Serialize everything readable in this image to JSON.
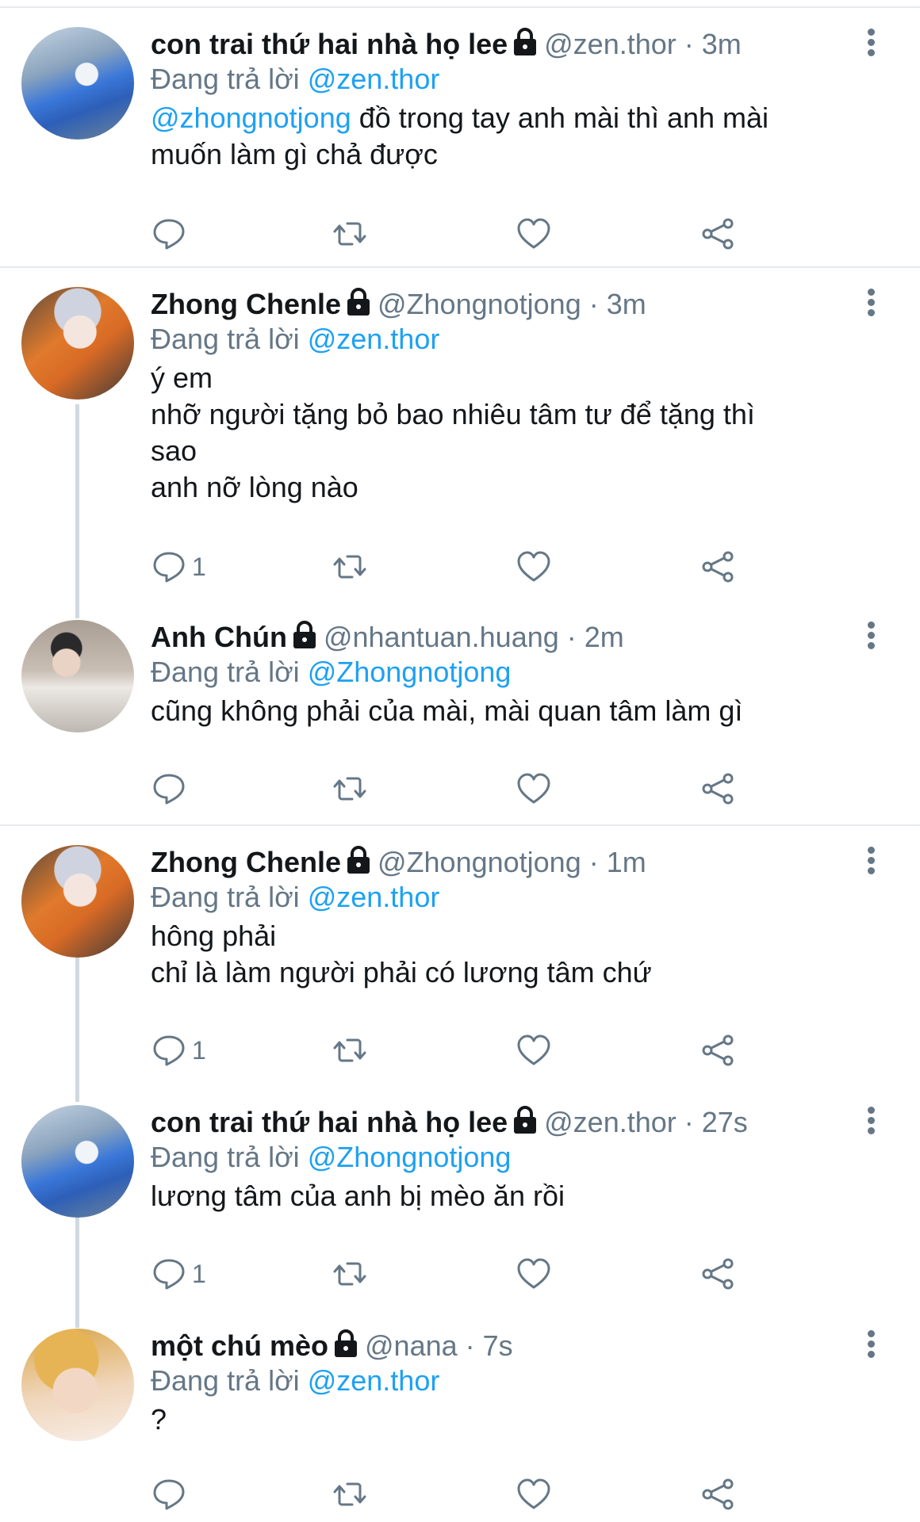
{
  "tweets": [
    {
      "name": "con trai thứ hai nhà họ lee",
      "handle": "@zen.thor",
      "time": "3m",
      "reply_prefix": "Đang trả lời",
      "reply_to": "@zen.thor",
      "mention": "@zhongnotjong",
      "text": " đồ trong tay anh mài thì anh mài\nmuốn làm gì chả được",
      "reply_count": ""
    },
    {
      "name": "Zhong Chenle",
      "handle": "@Zhongnotjong",
      "time": "3m",
      "reply_prefix": "Đang trả lời",
      "reply_to": "@zen.thor",
      "text": "ý em\nnhỡ người tặng bỏ bao nhiêu tâm tư để tặng thì\nsao\nanh nỡ lòng nào",
      "reply_count": "1"
    },
    {
      "name": "Anh Chún",
      "handle": "@nhantuan.huang",
      "time": "2m",
      "reply_prefix": "Đang trả lời",
      "reply_to": "@Zhongnotjong",
      "text": "cũng không phải của mài, mài quan tâm làm gì",
      "reply_count": ""
    },
    {
      "name": "Zhong Chenle",
      "handle": "@Zhongnotjong",
      "time": "1m",
      "reply_prefix": "Đang trả lời",
      "reply_to": "@zen.thor",
      "text": "hông phải\nchỉ là làm người phải có lương tâm chứ",
      "reply_count": "1"
    },
    {
      "name": "con trai thứ hai nhà họ lee",
      "handle": "@zen.thor",
      "time": "27s",
      "reply_prefix": "Đang trả lời",
      "reply_to": "@Zhongnotjong",
      "text": "lương tâm của anh bị mèo ăn rồi",
      "reply_count": "1"
    },
    {
      "name": "một chú mèo",
      "handle": "@nana",
      "time": "7s",
      "reply_prefix": "Đang trả lời",
      "reply_to": "@zen.thor",
      "text": "?",
      "reply_count": ""
    }
  ],
  "separator": " · ",
  "icons": [
    "lock-icon",
    "more-vertical-icon",
    "reply-icon",
    "retweet-icon",
    "like-icon",
    "share-icon"
  ],
  "colors": {
    "link": "#1da1f2",
    "muted": "#657786",
    "text": "#14171a",
    "divider": "#e6e9ec"
  }
}
